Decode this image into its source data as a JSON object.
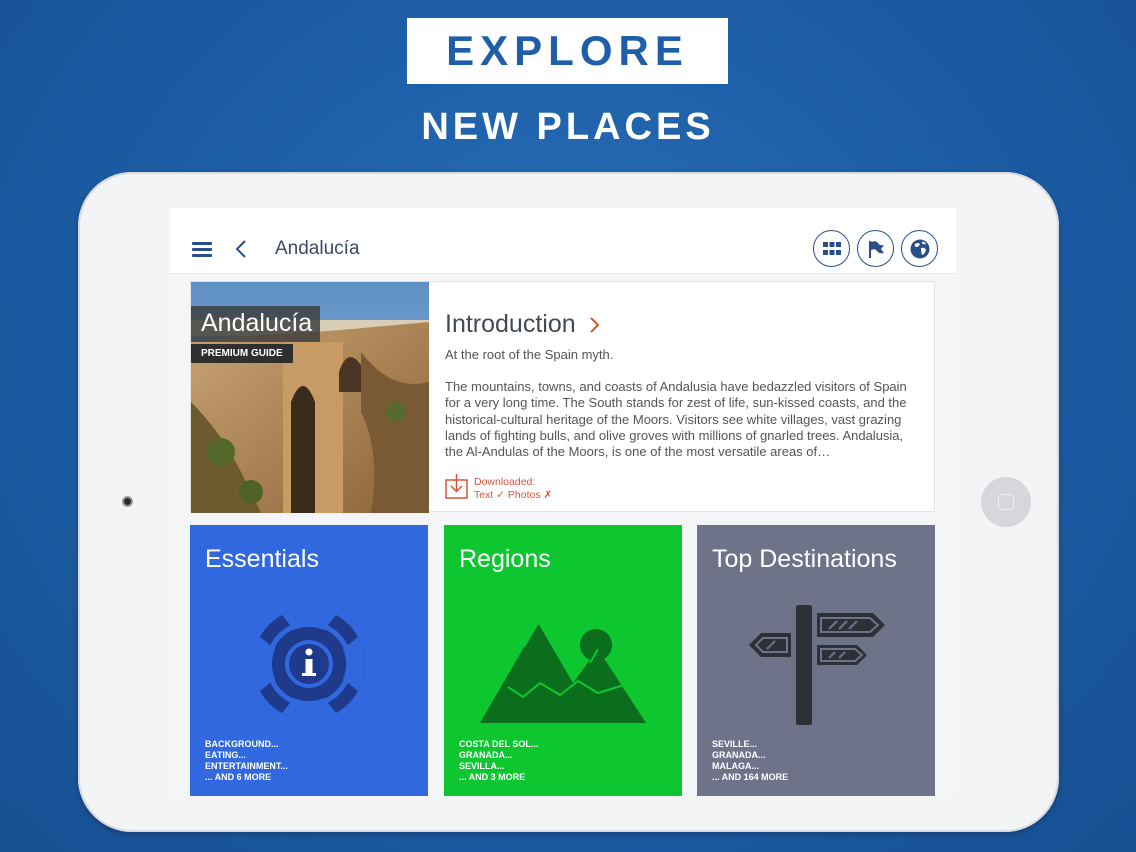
{
  "hero": {
    "headline": "EXPLORE",
    "subheadline": "NEW PLACES"
  },
  "topbar": {
    "title": "Andalucía",
    "icons": [
      "menu-icon",
      "back-icon",
      "grid-icon",
      "flag-icon",
      "globe-icon"
    ]
  },
  "intro": {
    "photo_label": "Andalucía",
    "photo_tag": "PREMIUM GUIDE",
    "title": "Introduction",
    "subtitle": "At the root of the Spain myth.",
    "body": "The mountains, towns, and coasts of Andalusia have bedazzled visitors of Spain for a very long time. The South stands for zest of life, sun-kissed coasts, and the historical-cultural heritage of the Moors. Visitors see white villages, vast grazing lands of fighting bulls, and olive groves with millions of gnarled trees. Andalusia, the Al-Andulas of the Moors, is one of the most versatile areas of…",
    "download_label": "Downloaded:",
    "download_status": "Text ✓ Photos ✗"
  },
  "tiles": [
    {
      "title": "Essentials",
      "color": "#3168e0",
      "icon": "lifebuoy-info-icon",
      "items": [
        "BACKGROUND...",
        "EATING...",
        "ENTERTAINMENT...",
        "... AND 6 MORE"
      ]
    },
    {
      "title": "Regions",
      "color": "#0dc630",
      "icon": "mountains-icon",
      "items": [
        "COSTA DEL SOL...",
        "GRANADA...",
        "SEVILLA...",
        "... AND 3 MORE"
      ]
    },
    {
      "title": "Top Destinations",
      "color": "#6f7389",
      "icon": "signpost-icon",
      "items": [
        "SEVILLE...",
        "GRANADA...",
        "MALAGA...",
        "... AND 164 MORE"
      ]
    }
  ],
  "colors": {
    "background": "#1d5fa8",
    "accent": "#2a4f86",
    "download": "#d9553b"
  }
}
